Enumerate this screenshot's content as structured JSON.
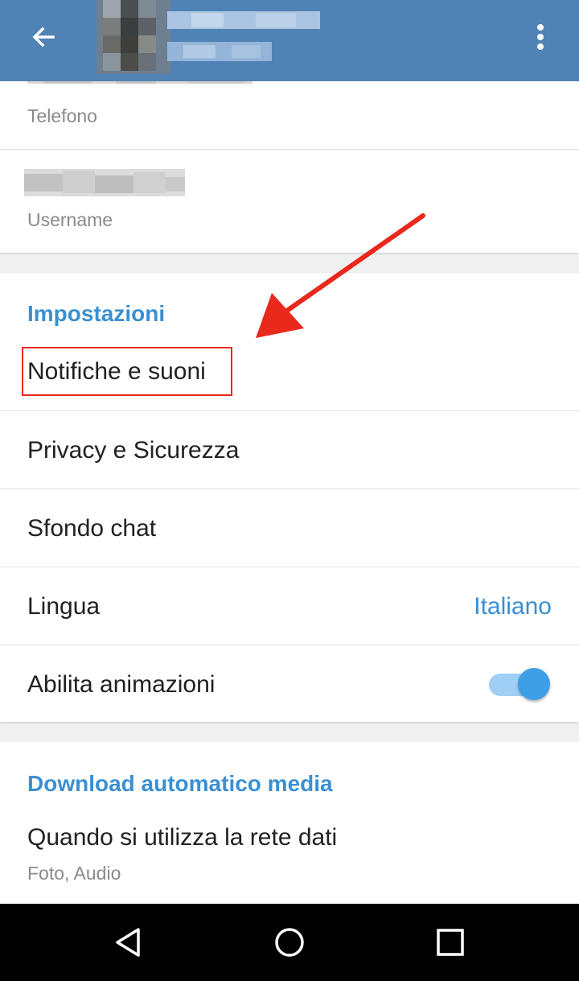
{
  "colors": {
    "app_bar": "#5182b5",
    "accent": "#3a8fd2",
    "annotation": "#e8291c",
    "toggle_on": "#3e9fe6"
  },
  "header": {
    "back_icon": "arrow-left-icon",
    "menu_icon": "more-vert-icon"
  },
  "profile": {
    "phone_label": "Telefono",
    "username_label": "Username"
  },
  "settings": {
    "title": "Impostazioni",
    "items": [
      {
        "label": "Notifiche e suoni"
      },
      {
        "label": "Privacy e Sicurezza"
      },
      {
        "label": "Sfondo chat"
      },
      {
        "label": "Lingua",
        "value": "Italiano"
      },
      {
        "label": "Abilita animazioni",
        "toggle": true
      }
    ]
  },
  "download": {
    "title": "Download automatico media",
    "mobile_label": "Quando si utilizza la rete dati",
    "mobile_sub": "Foto, Audio"
  },
  "navbar": {
    "back_icon": "nav-back-icon",
    "home_icon": "nav-home-icon",
    "recents_icon": "nav-recents-icon"
  }
}
